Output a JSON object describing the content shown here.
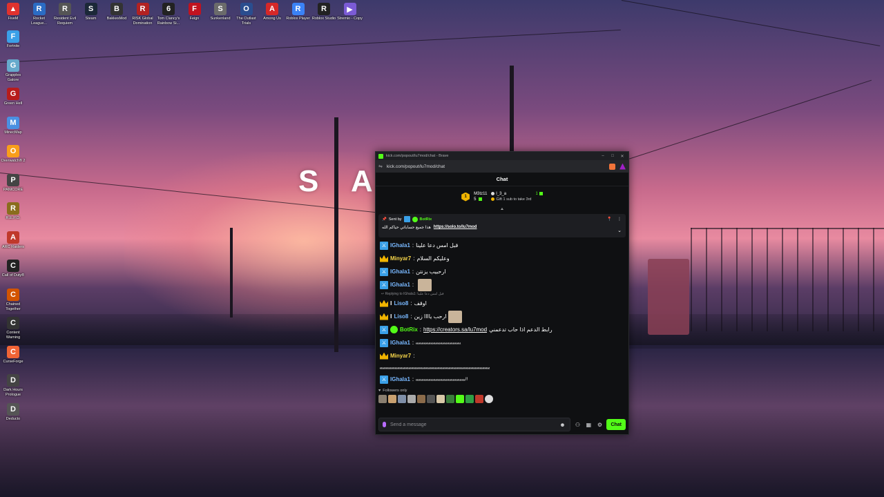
{
  "desktop": {
    "icons": [
      {
        "label": "FiveM",
        "icon": "fivem-icon",
        "color": "#e0322e",
        "glyph": "▲"
      },
      {
        "label": "Rocket League...",
        "icon": "rocket-league-icon",
        "color": "#2b6cc4",
        "glyph": "R"
      },
      {
        "label": "Resident Evil Requiem",
        "icon": "resident-evil-icon",
        "color": "#555555",
        "glyph": "R"
      },
      {
        "label": "Steam",
        "icon": "steam-icon",
        "color": "#1b2838",
        "glyph": "S"
      },
      {
        "label": "BakkesMod",
        "icon": "bakkesmod-icon",
        "color": "#333333",
        "glyph": "B"
      },
      {
        "label": "RISK Global Domination",
        "icon": "risk-icon",
        "color": "#b22222",
        "glyph": "R"
      },
      {
        "label": "Tom Clancy's Rainbow Si...",
        "icon": "rainbow-six-icon",
        "color": "#222222",
        "glyph": "6"
      },
      {
        "label": "Feign",
        "icon": "feign-icon",
        "color": "#c1121f",
        "glyph": "F"
      },
      {
        "label": "Sunkenland",
        "icon": "sunkenland-icon",
        "color": "#6b6b6b",
        "glyph": "S"
      },
      {
        "label": "The Outlast Trials",
        "icon": "outlast-icon",
        "color": "#2a4d8f",
        "glyph": "O"
      },
      {
        "label": "Among Us",
        "icon": "among-us-icon",
        "color": "#d62828",
        "glyph": "A"
      },
      {
        "label": "Roblox Player",
        "icon": "roblox-player-icon",
        "color": "#3b82f6",
        "glyph": "R"
      },
      {
        "label": "Roblox Studio",
        "icon": "roblox-studio-icon",
        "color": "#222222",
        "glyph": "R"
      },
      {
        "label": "Stremio - Copy",
        "icon": "stremio-icon",
        "color": "#7b5bd6",
        "glyph": "▶"
      }
    ],
    "side_icons": [
      {
        "label": "Fortnite",
        "icon": "fortnite-icon",
        "color": "#3aa0e8",
        "glyph": "F"
      },
      {
        "label": "Grapples Galore",
        "icon": "grapples-galore-icon",
        "color": "#66aacc",
        "glyph": "G"
      },
      {
        "label": "Green Hell",
        "icon": "green-hell-icon",
        "color": "#b71c1c",
        "glyph": "G"
      },
      {
        "label": "MinecMap",
        "icon": "minecmap-icon",
        "color": "#4a90e2",
        "glyph": "M"
      },
      {
        "label": "Overwatch® 2",
        "icon": "overwatch-icon",
        "color": "#f99e1a",
        "glyph": "O"
      },
      {
        "label": "PANICORE",
        "icon": "panicore-icon",
        "color": "#444444",
        "glyph": "P"
      },
      {
        "label": "R.E.P.O.",
        "icon": "repo-icon",
        "color": "#8a6d1d",
        "glyph": "R"
      },
      {
        "label": "ARC Raiders",
        "icon": "arc-raiders-icon",
        "color": "#c0392b",
        "glyph": "A"
      },
      {
        "label": "Call of Duty®",
        "icon": "call-of-duty-icon",
        "color": "#222222",
        "glyph": "C"
      },
      {
        "label": "Chained Together",
        "icon": "chained-together-icon",
        "color": "#d35400",
        "glyph": "C"
      },
      {
        "label": "Content Warning",
        "icon": "content-warning-icon",
        "color": "#333333",
        "glyph": "C"
      },
      {
        "label": "CurseForge",
        "icon": "curseforge-icon",
        "color": "#f16436",
        "glyph": "C"
      },
      {
        "label": "Dark Hours Prologue",
        "icon": "dark-hours-icon",
        "color": "#444444",
        "glyph": "D"
      },
      {
        "label": "Deducto",
        "icon": "deducto-icon",
        "color": "#555555",
        "glyph": "D"
      }
    ],
    "logo_text": "S A"
  },
  "window": {
    "title": "kick.com/popout/lu7mod/chat - Brave",
    "url": "kick.com/popout/lu7mod/chat",
    "chat_title": "Chat"
  },
  "leaderboard": {
    "rank1_number": "1",
    "rank1_name": "M3tz11",
    "rank1_count": "5",
    "rank2_name": "l_3_a",
    "rank2_count": "1",
    "gift_text": "Gift 1 sub to take 3rd"
  },
  "pinned": {
    "sent_by_label": "Sent by",
    "sender": "BotRix",
    "message": "هذا جميع حساباتي حياكم الله",
    "link": "https://solo.to/lu7mod"
  },
  "messages": [
    {
      "user": "IGhala1",
      "user_class": "u-blue",
      "badge": "x",
      "text": "قبل امس دعا علينا"
    },
    {
      "user": "Minyar7",
      "user_class": "u-yellow",
      "badge": "crown",
      "text": "وعليكم السلام"
    },
    {
      "user": "IGhala1",
      "user_class": "u-blue",
      "badge": "x",
      "text": "ارحبيب يزنتن"
    },
    {
      "user": "IGhala1",
      "user_class": "u-blue",
      "badge": "x",
      "text": "",
      "emote": true
    }
  ],
  "reply": {
    "note": "Replying to IGhala1:",
    "quoted": "قبل امس دعا علينا"
  },
  "messages2": [
    {
      "user": "Liso8",
      "user_class": "u-blue",
      "badge": "crown",
      "text": "اوقف"
    },
    {
      "user": "Liso8",
      "user_class": "u-blue",
      "badge": "crown",
      "text": "ارحب ياااا زين",
      "emote": true
    }
  ],
  "botrix_msg": {
    "user": "BotRix",
    "link": "https://creators.sa/lu7mod",
    "text": "رابط الدعم اذا حاب تدعمني"
  },
  "spam1": {
    "user": "IGhala1",
    "text": "ﯾﯾﯾﯾﯾﯾﯾﯾﯾﯾﯾﯾﯾﯾﯾﯾﯾﯾﯾﯾﯾﯾﯾﯾﯾﯾﯾﯾﯾﯾﯾﯾﯾﯾﯾﯾﯾﯾﯾ"
  },
  "spam2": {
    "user": "Minyar7",
    "text": "ﯾﯾﯾﯾﯾﯾﯾﯾﯾﯾﯾﯾﯾﯾﯾﯾﯾﯾﯾﯾﯾﯾﯾﯾﯾﯾﯾﯾﯾﯾﯾﯾﯾﯾﯾﯾﯾﯾﯾﯾﯾﯾﯾﯾﯾﯾﯾﯾﯾﯾﯾﯾﯾﯾﯾﯾﯾﯾﯾﯾﯾﯾﯾﯾﯾﯾﯾﯾﯾﯾﯾﯾﯾﯾﯾﯾﯾﯾﯾﯾﯾﯾﯾﯾﯾﯾﯾﯾ"
  },
  "spam3": {
    "user": "IGhala1",
    "text": "ﯾﯾﯾﯾﯾﯾﯾﯾﯾﯾﯾﯾﯾﯾﯾﯾﯾﯾﯾﯾﯾﯾﯾﯾﯾﯾﯾﯾﯾﯾﯾﯾﯾﯾﯾﯾﯾﯾﯾﯾﯾﯾﯾ!!"
  },
  "followers_only": "Followers only",
  "input": {
    "placeholder": "Send a message",
    "send_label": "Chat"
  },
  "colors": {
    "kick_green": "#53fc18",
    "window_bg": "#0f1012",
    "username_blue": "#79b8ff",
    "crown_gold": "#f0b400"
  }
}
